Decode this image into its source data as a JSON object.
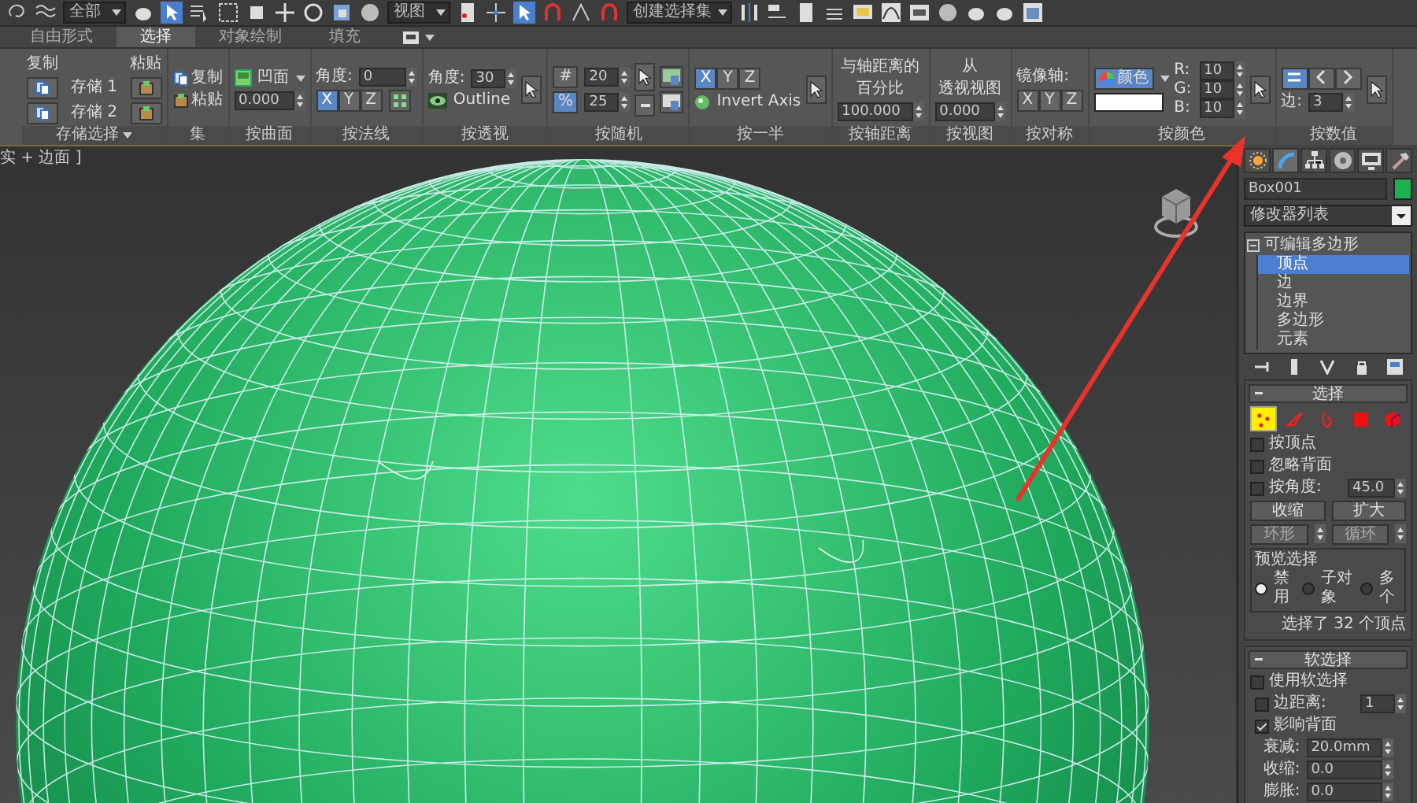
{
  "toolbar": {
    "dropdowns": [
      {
        "value": "全部"
      },
      {
        "value": "视图"
      },
      {
        "value": "创建选择集"
      }
    ]
  },
  "ribbon_tabs": [
    {
      "label": "自由形式",
      "selected": false
    },
    {
      "label": "选择",
      "selected": true
    },
    {
      "label": "对象绘制",
      "selected": false
    },
    {
      "label": "填充",
      "selected": false
    }
  ],
  "panels": [
    {
      "kind": "store",
      "title": "存储选择",
      "copy_label": "复制",
      "paste_label": "粘贴",
      "slots": [
        "存储 1",
        "存储 2"
      ]
    },
    {
      "kind": "set",
      "title": "集",
      "buttons": [
        "复制",
        "粘贴"
      ]
    },
    {
      "kind": "surface",
      "title": "按曲面",
      "mode": "凹面",
      "value": "0.000"
    },
    {
      "kind": "normal",
      "title": "按法线",
      "angle_label": "角度:",
      "angle": "0",
      "axes": [
        {
          "label": "X",
          "selected": true
        },
        {
          "label": "Y",
          "selected": false
        },
        {
          "label": "Z",
          "selected": false
        }
      ]
    },
    {
      "kind": "perspective",
      "title": "按透视",
      "angle_label": "角度:",
      "angle": "30",
      "outline": "Outline"
    },
    {
      "kind": "random",
      "title": "按随机",
      "options": [
        {
          "symbol": "#",
          "value": "20",
          "selected": false
        },
        {
          "symbol": "%",
          "value": "25",
          "selected": true
        }
      ]
    },
    {
      "kind": "half",
      "title": "按一半",
      "axes": [
        {
          "label": "X",
          "selected": true
        },
        {
          "label": "Y",
          "selected": false
        },
        {
          "label": "Z",
          "selected": false
        }
      ],
      "invert": "Invert Axis"
    },
    {
      "kind": "caption",
      "title": "按轴距离",
      "caption": [
        "与轴距离的",
        "百分比"
      ],
      "value": "100.000"
    },
    {
      "kind": "caption",
      "title": "按视图",
      "caption": [
        "从",
        "透视视图"
      ],
      "value": "0.000"
    },
    {
      "kind": "symmetry",
      "title": "按对称",
      "axis_label": "镜像轴:",
      "axes": [
        {
          "label": "X",
          "selected": false
        },
        {
          "label": "Y",
          "selected": false
        },
        {
          "label": "Z",
          "selected": false
        }
      ]
    },
    {
      "kind": "color",
      "title": "按颜色",
      "button": "颜色",
      "color": "#ffffff",
      "channels": [
        {
          "label": "R:",
          "value": "10"
        },
        {
          "label": "G:",
          "value": "10"
        },
        {
          "label": "B:",
          "value": "10"
        }
      ]
    },
    {
      "kind": "numeric",
      "title": "按数值",
      "modes": [
        {
          "kind": "equal",
          "selected": true
        },
        {
          "kind": "less",
          "selected": false
        },
        {
          "kind": "greater",
          "selected": false
        }
      ],
      "edge_label": "边:",
      "value": "3"
    }
  ],
  "viewport": {
    "label": "实 + 边面 ]"
  },
  "command_panel": {
    "tabs": [
      {
        "kind": "create",
        "selected": false
      },
      {
        "kind": "modify",
        "selected": true
      },
      {
        "kind": "hierarchy",
        "selected": false
      },
      {
        "kind": "motion",
        "selected": false
      },
      {
        "kind": "display",
        "selected": false
      },
      {
        "kind": "utilities",
        "selected": false
      }
    ],
    "object": {
      "name": "Box001",
      "color": "#1fb14f"
    },
    "modifier_list": "修改器列表",
    "stack": [
      {
        "label": "可编辑多边形",
        "expanded": true,
        "children": [
          {
            "label": "顶点",
            "selected": true
          },
          {
            "label": "边",
            "selected": false
          },
          {
            "label": "边界",
            "selected": false
          },
          {
            "label": "多边形",
            "selected": false
          },
          {
            "label": "元素",
            "selected": false
          }
        ]
      }
    ],
    "selection": {
      "title": "选择",
      "levels": [
        {
          "kind": "vertex",
          "selected": true
        },
        {
          "kind": "edge",
          "selected": false
        },
        {
          "kind": "border",
          "selected": false
        },
        {
          "kind": "polygon",
          "selected": false
        },
        {
          "kind": "element",
          "selected": false
        }
      ],
      "checks": [
        {
          "label": "按顶点",
          "checked": false
        },
        {
          "label": "忽略背面",
          "checked": false
        },
        {
          "label": "按角度:",
          "checked": false,
          "value": "45.0"
        }
      ],
      "buttons": [
        "收缩",
        "扩大"
      ],
      "spin_buttons": [
        "环形",
        "循环"
      ],
      "preview": {
        "title": "预览选择",
        "options": [
          {
            "label": "禁用",
            "selected": true
          },
          {
            "label": "子对象",
            "selected": false
          },
          {
            "label": "多个",
            "selected": false
          }
        ]
      },
      "status": "选择了 32 个顶点"
    },
    "soft_selection": {
      "title": "软选择",
      "use": {
        "label": "使用软选择",
        "checked": false
      },
      "edge_distance": {
        "label": "边距离:",
        "checked": false,
        "value": "1"
      },
      "affect_back": {
        "label": "影响背面",
        "checked": true
      },
      "params": [
        {
          "label": "衰减:",
          "value": "20.0mm"
        },
        {
          "label": "收缩:",
          "value": "0.0"
        },
        {
          "label": "膨胀:",
          "value": "0.0"
        }
      ]
    }
  }
}
